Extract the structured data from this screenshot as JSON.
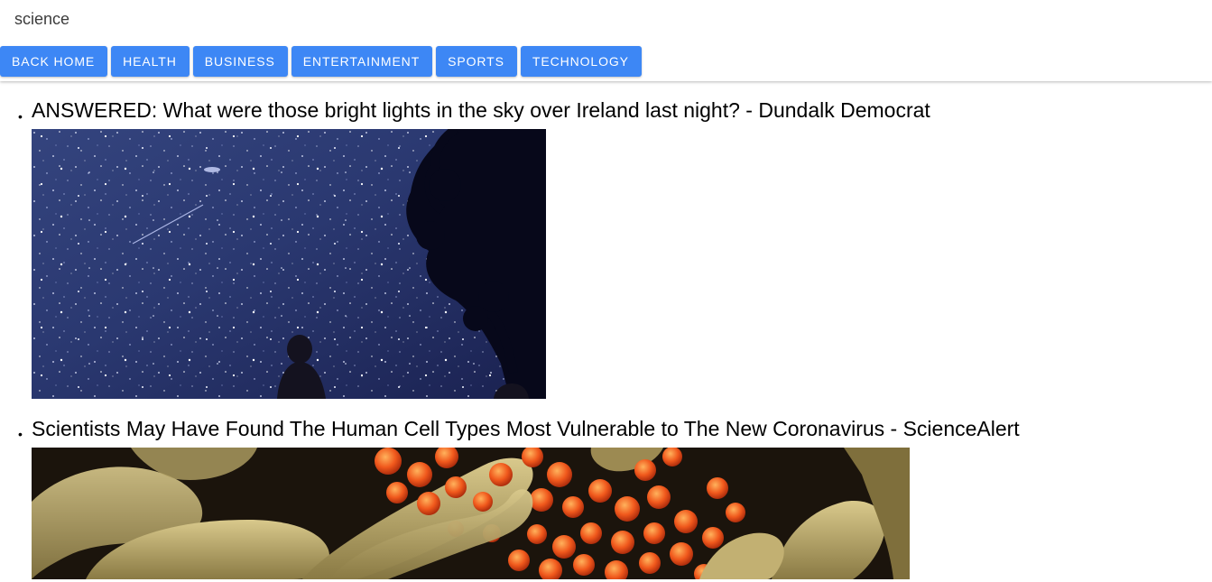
{
  "page": {
    "section_title": "science"
  },
  "nav": {
    "buttons": [
      {
        "label": "BACK HOME"
      },
      {
        "label": "HEALTH"
      },
      {
        "label": "BUSINESS"
      },
      {
        "label": "ENTERTAINMENT"
      },
      {
        "label": "SPORTS"
      },
      {
        "label": "TECHNOLOGY"
      }
    ]
  },
  "articles": [
    {
      "bullet": "•",
      "title": "ANSWERED: What were those bright lights in the sky over Ireland last night? - Dundalk Democrat",
      "image_icon": "night-sky-meteor-photo"
    },
    {
      "bullet": "•",
      "title": "Scientists May Have Found The Human Cell Types Most Vulnerable to The New Coronavirus - ScienceAlert",
      "image_icon": "virus-microscope-photo"
    }
  ],
  "colors": {
    "button_bg": "#3d87f5",
    "button_text": "#ffffff",
    "header_bg": "#ffffff",
    "section_title": "#3c3c3c"
  }
}
